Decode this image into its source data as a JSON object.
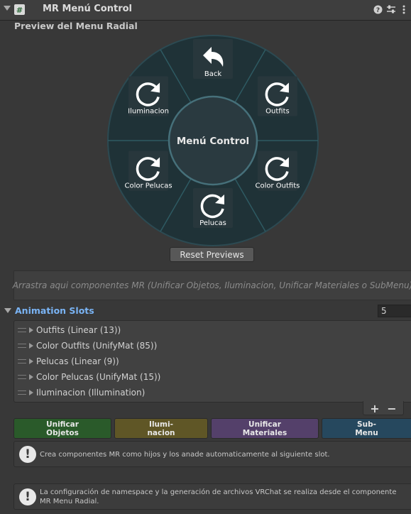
{
  "header": {
    "title": "MR Menú Control",
    "icons": [
      "help-icon",
      "sliders-icon",
      "more-icon"
    ]
  },
  "preview": {
    "title": "Preview del Menu Radial",
    "center_label": "Menú Control",
    "segments": [
      {
        "label": "Back",
        "icon": "back-arrow-icon"
      },
      {
        "label": "Outfits",
        "icon": "refresh-icon"
      },
      {
        "label": "Color Outfits",
        "icon": "refresh-icon"
      },
      {
        "label": "Pelucas",
        "icon": "refresh-icon"
      },
      {
        "label": "Color Pelucas",
        "icon": "refresh-icon"
      },
      {
        "label": "Iluminacion",
        "icon": "refresh-icon"
      }
    ],
    "reset_label": "Reset Previews"
  },
  "dropzone": {
    "text": "Arrastra aqui componentes MR (Unificar Objetos, Iluminacion, Unificar Materiales o SubMenu)"
  },
  "slots": {
    "title": "Animation Slots",
    "count": "5",
    "items": [
      {
        "label": "Outfits (Linear (13))"
      },
      {
        "label": "Color Outfits (UnifyMat (85))"
      },
      {
        "label": "Pelucas (Linear (9))"
      },
      {
        "label": "Color Pelucas (UnifyMat (15))"
      },
      {
        "label": "Iluminacion (Illumination)"
      }
    ],
    "add_label": "+",
    "remove_label": "−"
  },
  "create_buttons": [
    {
      "label": "Unificar\nObjetos",
      "color": "#2a5a2a"
    },
    {
      "label": "Ilumi-\nnacion",
      "color": "#5f5626"
    },
    {
      "label": "Unificar\nMateriales",
      "color": "#54406a"
    },
    {
      "label": "Sub-\nMenu",
      "color": "#26485e"
    }
  ],
  "help": [
    {
      "text": "Crea componentes MR como hijos y los anade automaticamente al siguiente slot."
    },
    {
      "text": "La configuración de namespace y la generación de archivos VRChat se realiza desde el componente MR Menu Radial."
    }
  ],
  "colors": {
    "background": "#383838",
    "wheel_outer": "#1f3237",
    "wheel_lines": "#2e5a62",
    "accent_blue": "#7ab4f5"
  }
}
